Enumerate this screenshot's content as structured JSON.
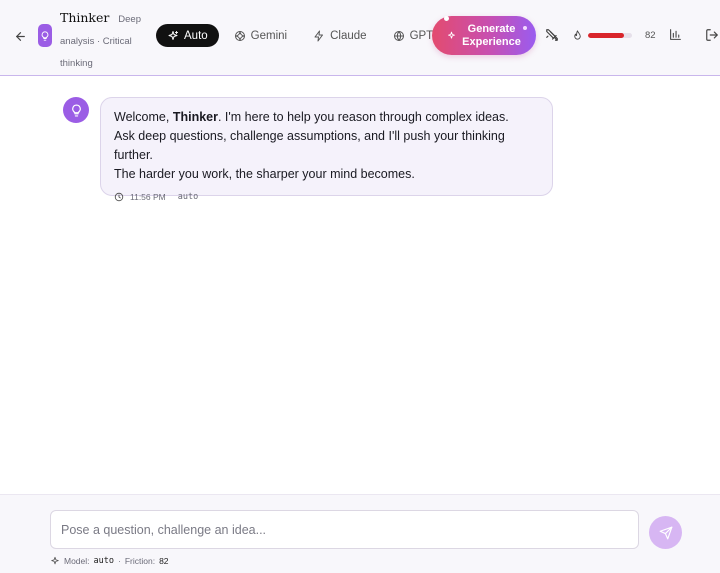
{
  "header": {
    "agent_name": "Thinker",
    "agent_desc_1": "Deep",
    "agent_desc_2": "analysis · Critical",
    "agent_desc_3": "thinking",
    "tabs": [
      {
        "label": "Auto",
        "icon": "sparkles-icon",
        "active": true
      },
      {
        "label": "Gemini",
        "icon": "gemini-icon",
        "active": false
      },
      {
        "label": "Claude",
        "icon": "claude-icon",
        "active": false
      },
      {
        "label": "GPT",
        "icon": "globe-icon",
        "active": false
      }
    ],
    "generate_line1": "Generate",
    "generate_line2": "Experience",
    "friction_value": "82",
    "friction_fraction": 0.82,
    "accent_color": "#9b5de5",
    "friction_color": "#d9252b"
  },
  "message": {
    "welcome_prefix": "Welcome, ",
    "welcome_name": "Thinker",
    "welcome_suffix": ". I'm here to help you reason through complex ideas.",
    "line2": "Ask deep questions, challenge assumptions, and I'll push your thinking further.",
    "line3": "The harder you work, the sharper your mind becomes.",
    "time": "11:56 PM",
    "model": "auto"
  },
  "footer": {
    "placeholder": "Pose a question, challenge an idea...",
    "model_label": "Model:",
    "model_value": "auto",
    "separator": "·",
    "friction_label": "Friction:",
    "friction_value": "82"
  }
}
